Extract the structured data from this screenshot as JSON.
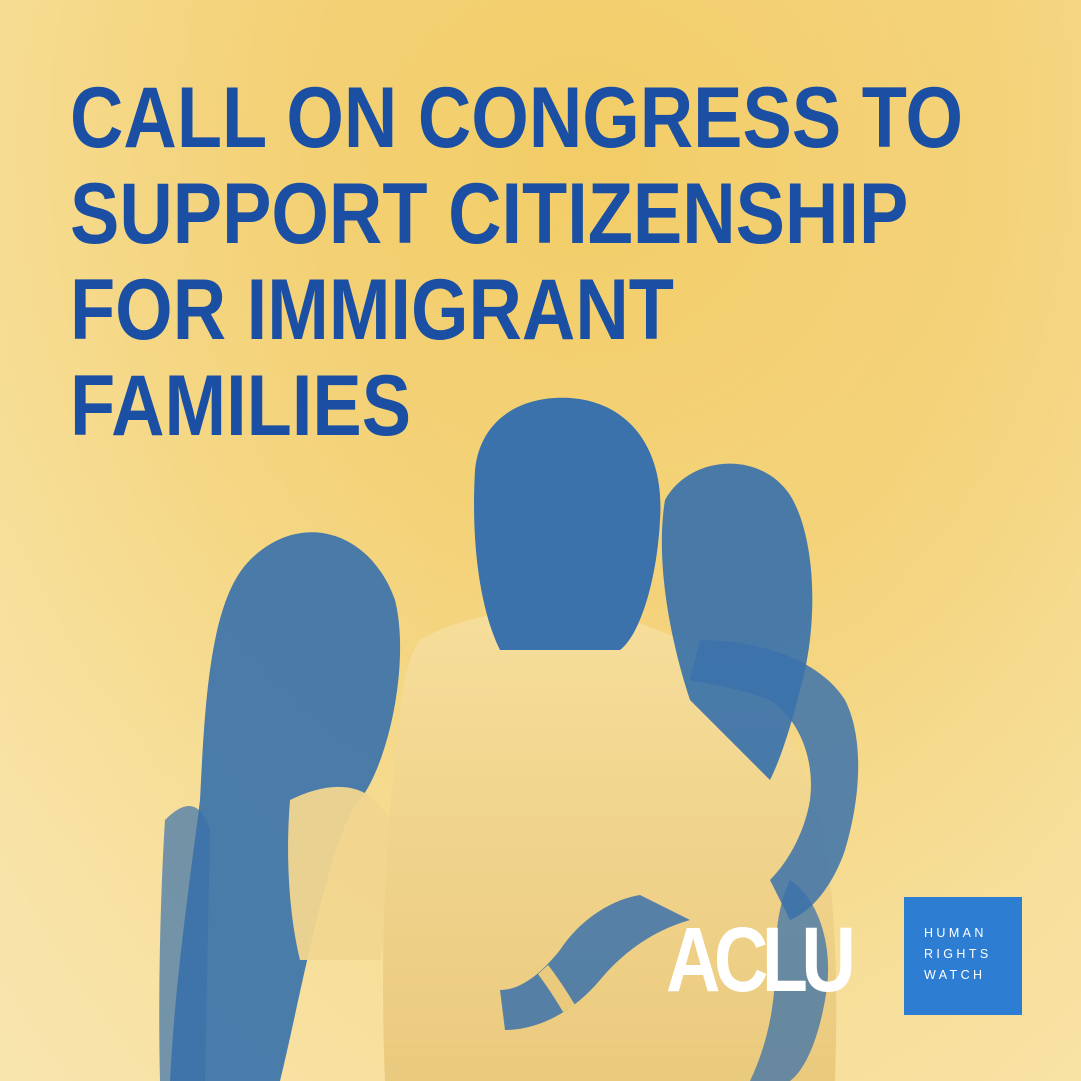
{
  "headline": {
    "line1": "CALL ON CONGRESS TO",
    "line2": "SUPPORT CITIZENSHIP",
    "line3": "FOR IMMIGRANT",
    "line4": "FAMILIES"
  },
  "logos": {
    "aclu": "ACLU",
    "hrw": {
      "line1": "HUMAN",
      "line2": "RIGHTS",
      "line3": "WATCH"
    }
  },
  "colors": {
    "background": "#f0c558",
    "headline": "#1a4fa3",
    "silhouette": "#2f6aa8",
    "hrw_box": "#2d7ed3",
    "logo_text": "#ffffff"
  },
  "image": {
    "subject": "family-of-three-from-behind"
  }
}
